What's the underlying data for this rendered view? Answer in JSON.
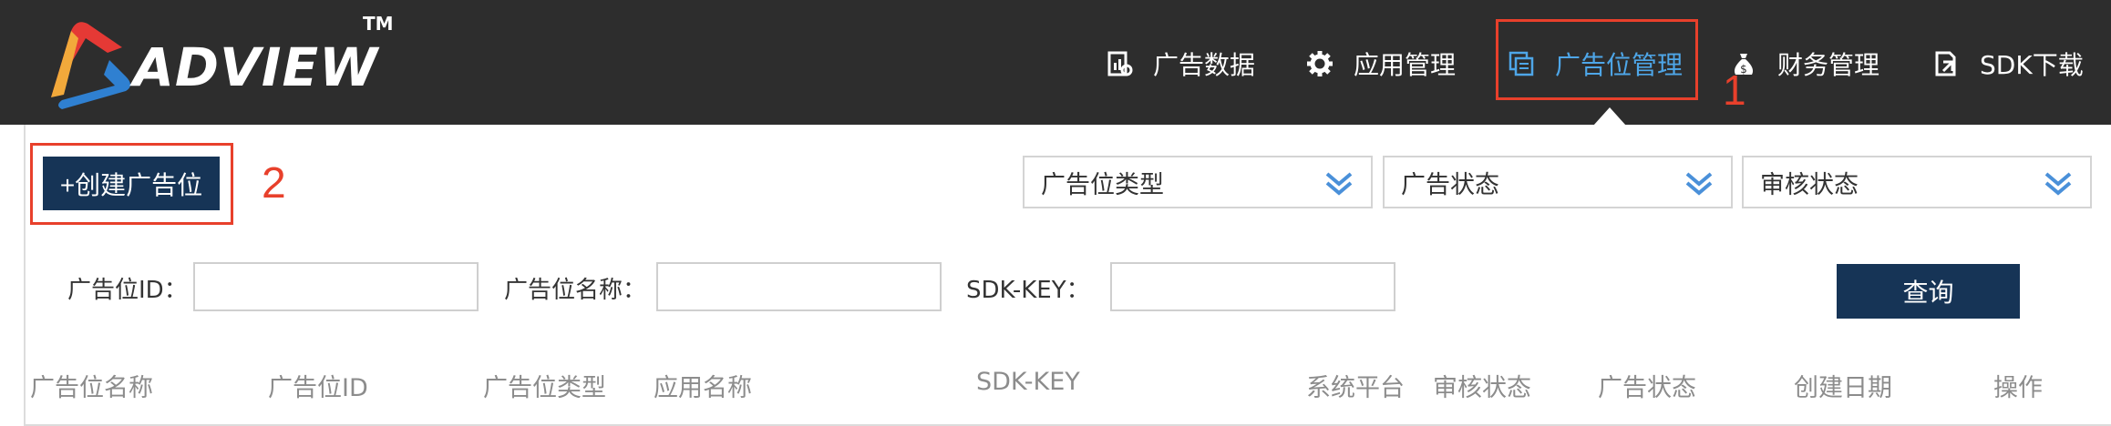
{
  "brand": {
    "name": "ADVIEW",
    "tm": "TM"
  },
  "nav": [
    {
      "label": "广告数据",
      "icon": "chart-report-icon"
    },
    {
      "label": "应用管理",
      "icon": "gear-icon"
    },
    {
      "label": "广告位管理",
      "icon": "layers-icon",
      "active": true
    },
    {
      "label": "财务管理",
      "icon": "money-bag-icon"
    },
    {
      "label": "SDK下载",
      "icon": "download-doc-icon"
    }
  ],
  "annotations": {
    "one": "1",
    "two": "2"
  },
  "toolbar": {
    "create_label": "+创建广告位"
  },
  "filters": {
    "slot_type": "广告位类型",
    "ad_status": "广告状态",
    "review_status": "审核状态"
  },
  "search": {
    "slot_id_label": "广告位ID：",
    "slot_id_value": "",
    "slot_name_label": "广告位名称：",
    "slot_name_value": "",
    "sdk_key_label": "SDK-KEY：",
    "sdk_key_value": "",
    "query_label": "查询"
  },
  "table": {
    "columns": [
      "广告位名称",
      "广告位ID",
      "广告位类型",
      "应用名称",
      "SDK-KEY",
      "系统平台",
      "审核状态",
      "广告状态",
      "创建日期",
      "操作"
    ]
  },
  "colors": {
    "topbar": "#2d2d2d",
    "active_nav": "#4ea6e8",
    "button": "#163456",
    "annotation": "#e8402b",
    "chevron": "#4a90d9"
  }
}
